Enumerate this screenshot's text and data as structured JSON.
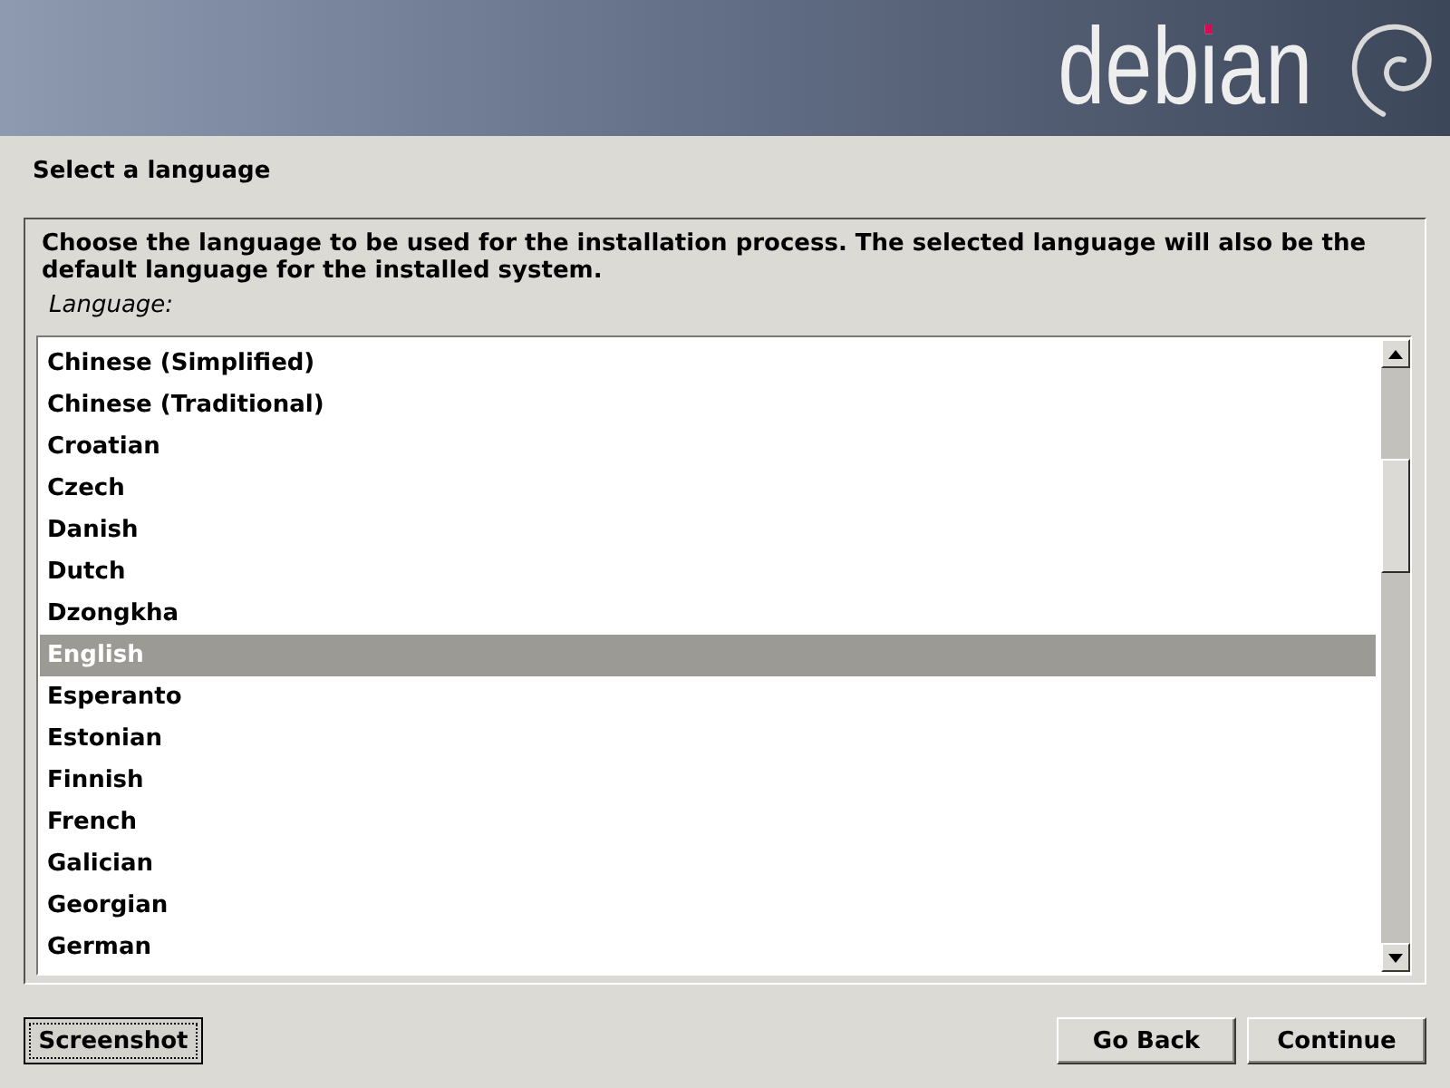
{
  "header": {
    "logo_text": "debian"
  },
  "page": {
    "title": "Select a language"
  },
  "panel": {
    "description": "Choose the language to be used for the installation process. The selected language will also be the default language for the installed system.",
    "field_label": "Language:",
    "languages": [
      {
        "label": "Chinese (Simplified)",
        "selected": false
      },
      {
        "label": "Chinese (Traditional)",
        "selected": false
      },
      {
        "label": "Croatian",
        "selected": false
      },
      {
        "label": "Czech",
        "selected": false
      },
      {
        "label": "Danish",
        "selected": false
      },
      {
        "label": "Dutch",
        "selected": false
      },
      {
        "label": "Dzongkha",
        "selected": false
      },
      {
        "label": "English",
        "selected": true
      },
      {
        "label": "Esperanto",
        "selected": false
      },
      {
        "label": "Estonian",
        "selected": false
      },
      {
        "label": "Finnish",
        "selected": false
      },
      {
        "label": "French",
        "selected": false
      },
      {
        "label": "Galician",
        "selected": false
      },
      {
        "label": "Georgian",
        "selected": false
      },
      {
        "label": "German",
        "selected": false
      }
    ]
  },
  "footer": {
    "left_buttons": [
      {
        "label": "Screenshot",
        "focused": true
      }
    ],
    "right_buttons": [
      {
        "label": "Go Back",
        "focused": false
      },
      {
        "label": "Continue",
        "focused": false
      }
    ]
  }
}
